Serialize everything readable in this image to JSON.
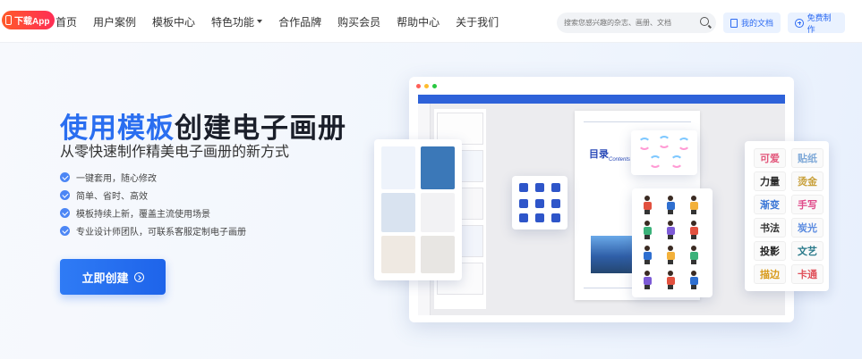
{
  "nav": {
    "app_badge": "下载App",
    "links": [
      "首页",
      "用户案例",
      "模板中心",
      "特色功能",
      "合作品牌",
      "购买会员",
      "帮助中心",
      "关于我们"
    ],
    "dropdown_link_index": 3,
    "search_placeholder": "搜索您感兴趣的杂志、画册、文档",
    "my_docs": "我的文档",
    "free_create": "免费制作"
  },
  "hero": {
    "title_highlight": "使用模板",
    "title_rest": "创建电子画册",
    "subtitle": "从零快速制作精美电子画册的新方式",
    "features": [
      "一键套用，随心修改",
      "简单、省时、高效",
      "模板持续上新，覆盖主流使用场景",
      "专业设计师团队，可联系客服定制电子画册"
    ],
    "cta": "立即创建"
  },
  "mockup": {
    "page_heading": "目录",
    "page_heading_en": "Contents",
    "stickers": [
      "可爱",
      "贴纸",
      "力量",
      "烫金",
      "渐变",
      "手写",
      "书法",
      "炭光",
      "投影",
      "文艺",
      "描边",
      "卡通"
    ],
    "sticker_colors": [
      "#e2557a",
      "#7fa9d8",
      "#2b2b2b",
      "#c8a03a",
      "#3a76d6",
      "#e04a8a",
      "#333333",
      "#5b8be0",
      "#222222",
      "#2a7a8a",
      "#d89a1a",
      "#e0505a"
    ]
  },
  "colors": {
    "accent": "#2a6ef0",
    "badge": "#ff3d3d",
    "toolbar": "#2e62d9"
  }
}
